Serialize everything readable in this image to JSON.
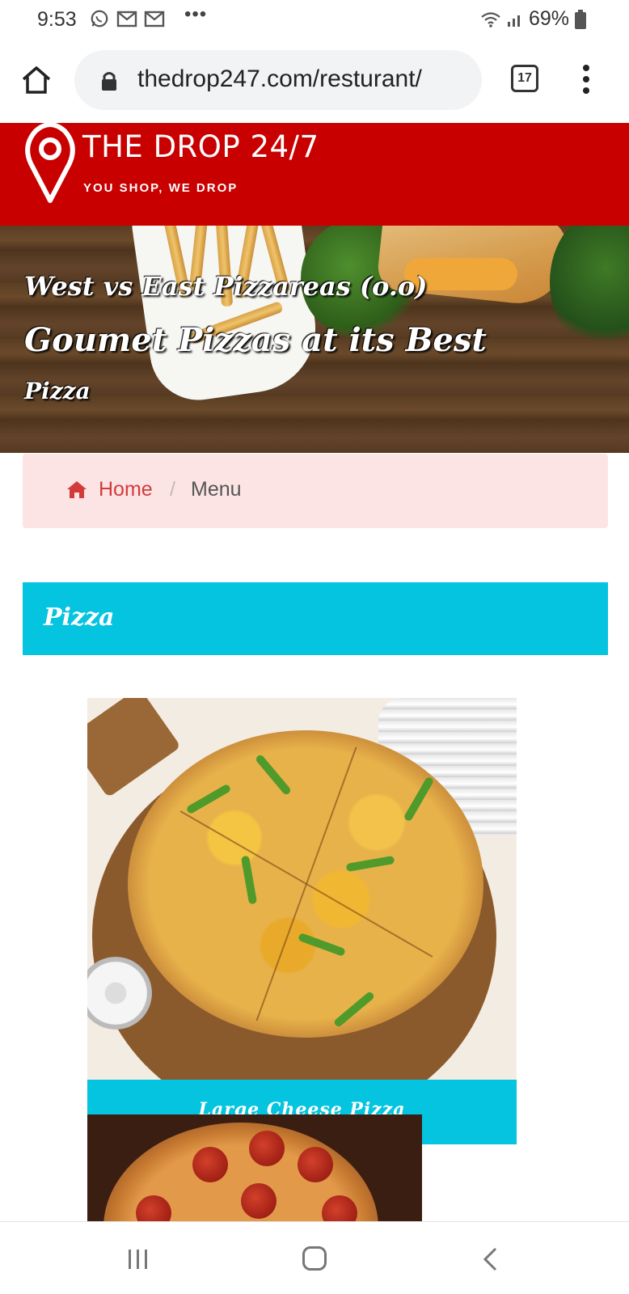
{
  "status_bar": {
    "time": "9:53",
    "battery": "69%",
    "icons": [
      "whatsapp-icon",
      "gmail-icon",
      "gmail-icon",
      "more-notifications-icon",
      "wifi-icon",
      "signal-icon",
      "battery-icon"
    ],
    "more": "•••"
  },
  "browser": {
    "url": "thedrop247.com/resturant/",
    "tab_count": "17",
    "icons": [
      "home-icon",
      "lock-icon",
      "tabs-icon",
      "overflow-menu-icon"
    ]
  },
  "header": {
    "brand": "THE DROP 24/7",
    "tagline": "YOU SHOP, WE DROP",
    "background_color": "#c80000"
  },
  "hero": {
    "line1": "West vs East Pizzareas (o.o)",
    "line2": "Goumet Pizzas at its Best",
    "line3": "Pizza"
  },
  "breadcrumb": {
    "home": "Home",
    "separator": "/",
    "current": "Menu"
  },
  "category": {
    "title": "Pizza",
    "color": "#05c4e0"
  },
  "products": [
    {
      "name": "Large Cheese Pizza"
    }
  ],
  "nav": {
    "icons": [
      "recent-apps-icon",
      "home-button-icon",
      "back-icon"
    ]
  }
}
